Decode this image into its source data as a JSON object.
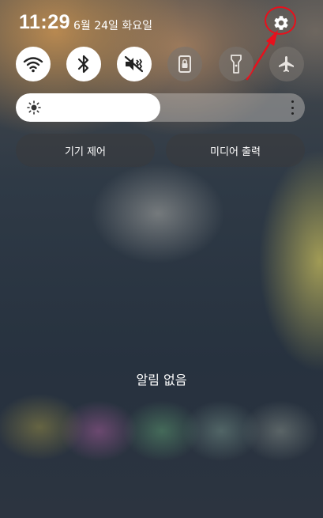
{
  "status": {
    "time": "11:29",
    "date": "6월 24일 화요일"
  },
  "quick_settings": [
    {
      "name": "wifi",
      "icon": "wifi-icon",
      "state": "on"
    },
    {
      "name": "bluetooth",
      "icon": "bluetooth-icon",
      "state": "on"
    },
    {
      "name": "sound",
      "icon": "vibrate-icon",
      "state": "on"
    },
    {
      "name": "rotation-lock",
      "icon": "portrait-lock-icon",
      "state": "off"
    },
    {
      "name": "flashlight",
      "icon": "flashlight-icon",
      "state": "off"
    },
    {
      "name": "airplane-mode",
      "icon": "airplane-icon",
      "state": "off"
    }
  ],
  "brightness": {
    "level": 0.5
  },
  "buttons": {
    "device_control": "기기 제어",
    "media_output": "미디어 출력"
  },
  "notifications": {
    "empty_text": "알림 없음"
  },
  "annotation": {
    "color": "#e8101c",
    "target": "settings-gear-icon"
  }
}
